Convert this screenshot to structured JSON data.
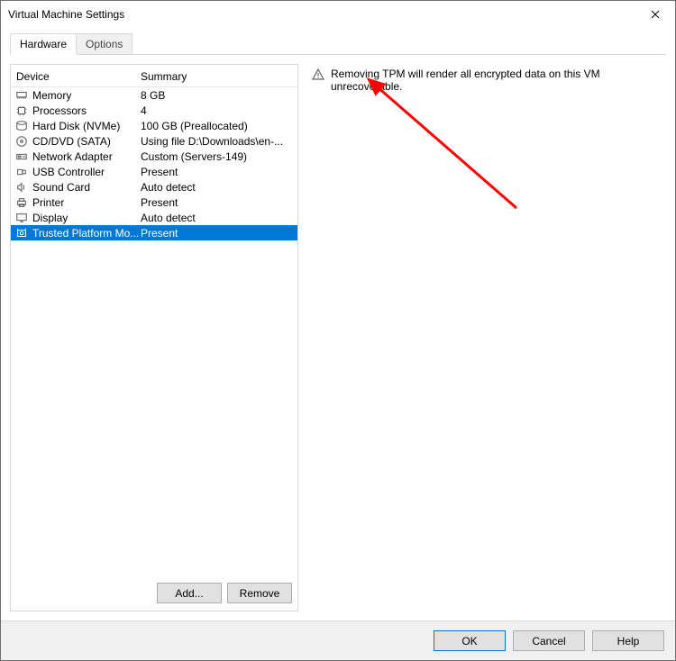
{
  "window": {
    "title": "Virtual Machine Settings"
  },
  "tabs": {
    "hardware": "Hardware",
    "options": "Options"
  },
  "columns": {
    "device": "Device",
    "summary": "Summary"
  },
  "devices": [
    {
      "icon": "memory-icon",
      "name": "Memory",
      "summary": "8 GB",
      "selected": false
    },
    {
      "icon": "cpu-icon",
      "name": "Processors",
      "summary": "4",
      "selected": false
    },
    {
      "icon": "disk-icon",
      "name": "Hard Disk (NVMe)",
      "summary": "100 GB (Preallocated)",
      "selected": false
    },
    {
      "icon": "cd-icon",
      "name": "CD/DVD (SATA)",
      "summary": "Using file D:\\Downloads\\en-...",
      "selected": false
    },
    {
      "icon": "network-icon",
      "name": "Network Adapter",
      "summary": "Custom (Servers-149)",
      "selected": false
    },
    {
      "icon": "usb-icon",
      "name": "USB Controller",
      "summary": "Present",
      "selected": false
    },
    {
      "icon": "sound-icon",
      "name": "Sound Card",
      "summary": "Auto detect",
      "selected": false
    },
    {
      "icon": "printer-icon",
      "name": "Printer",
      "summary": "Present",
      "selected": false
    },
    {
      "icon": "display-icon",
      "name": "Display",
      "summary": "Auto detect",
      "selected": false
    },
    {
      "icon": "tpm-icon",
      "name": "Trusted Platform Mo...",
      "summary": "Present",
      "selected": true
    }
  ],
  "buttons": {
    "add": "Add...",
    "remove": "Remove",
    "ok": "OK",
    "cancel": "Cancel",
    "help": "Help"
  },
  "detail": {
    "warning": "Removing TPM will render all encrypted data on this VM unrecoverable."
  }
}
